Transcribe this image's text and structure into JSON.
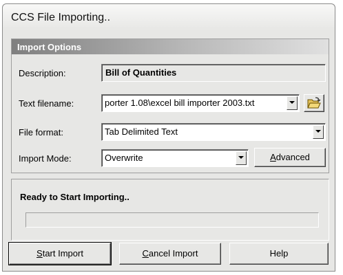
{
  "window": {
    "title": "CCS File Importing.."
  },
  "import_options": {
    "heading": "Import Options",
    "description": {
      "label": "Description:",
      "value": "Bill of Quantities"
    },
    "text_filename": {
      "label": "Text filename:",
      "value": "porter 1.08\\excel bill importer 2003.txt"
    },
    "file_format": {
      "label": "File format:",
      "value": "Tab Delimited Text"
    },
    "import_mode": {
      "label": "Import Mode:",
      "value": "Overwrite"
    },
    "advanced_button": {
      "prefix": "",
      "accel": "A",
      "rest": "dvanced"
    }
  },
  "status": {
    "text": "Ready to Start Importing..",
    "progress": 0
  },
  "buttons": {
    "start": {
      "accel": "S",
      "rest": "tart Import"
    },
    "cancel": {
      "accel": "C",
      "rest": "ancel Import"
    },
    "help": {
      "label": "Help"
    }
  },
  "icons": {
    "browse": "open-folder-icon",
    "dropdown": "chevron-down-icon"
  },
  "colors": {
    "dialog_bg": "#e7e7e5",
    "group_header": "#7f7f7f",
    "progress": "#0a246a"
  }
}
